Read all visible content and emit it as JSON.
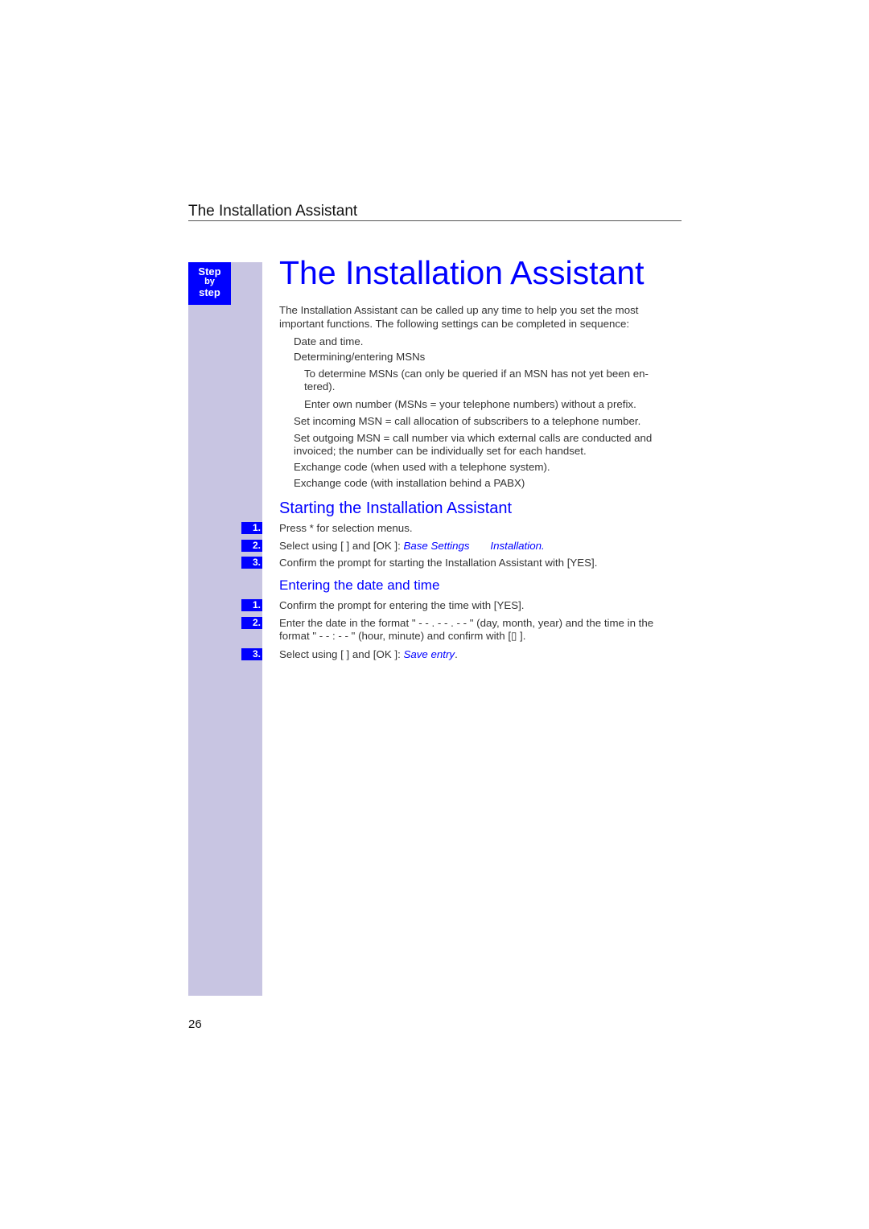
{
  "running_head": "The Installation Assistant",
  "step_badge": {
    "line1": "Step",
    "line2": "by",
    "line3": "step"
  },
  "title": "The Installation Assistant",
  "intro": {
    "line1": "The Installation Assistant can be called up any time to help you set the most",
    "line2": "important functions. The following settings can be completed in sequence:"
  },
  "settings": [
    "Date and time.",
    "Determining/entering MSNs",
    "To determine MSNs (can only be queried if an MSN has not yet been en-",
    "tered).",
    "Enter own number (MSNs = your telephone numbers) without a prefix.",
    "Set incoming MSN = call allocation of subscribers to a telephone number.",
    "Set outgoing MSN = call number via which external calls are conducted and",
    "invoiced; the number can be individually set for each handset.",
    "Exchange code (when used with a telephone system).",
    "Exchange code (with installation behind a PABX)"
  ],
  "section_start": {
    "heading": "Starting the Installation Assistant",
    "steps": [
      {
        "num": "1.",
        "text": "Press *     for selection menus."
      },
      {
        "num": "2.",
        "text_pre": "Select using [   ] and [OK ]: ",
        "link1": "Base Settings",
        "link2": "Installation."
      },
      {
        "num": "3.",
        "text": "Confirm the prompt for starting the Installation Assistant with [YES]."
      }
    ]
  },
  "section_date": {
    "heading": "Entering the date and time",
    "steps": [
      {
        "num": "1.",
        "text": "Confirm the prompt for entering the time with [YES]."
      },
      {
        "num": "2.",
        "line1": "Enter the date in the format \" - - . - - . - - \" (day, month, year) and the time in the",
        "line2": "format \" - - : - - \" (hour, minute) and confirm with [▯   ]."
      },
      {
        "num": "3.",
        "text_pre": "Select using [   ] and [OK ]: ",
        "link": "Save entry",
        "text_post": "."
      }
    ]
  },
  "page_number": "26"
}
